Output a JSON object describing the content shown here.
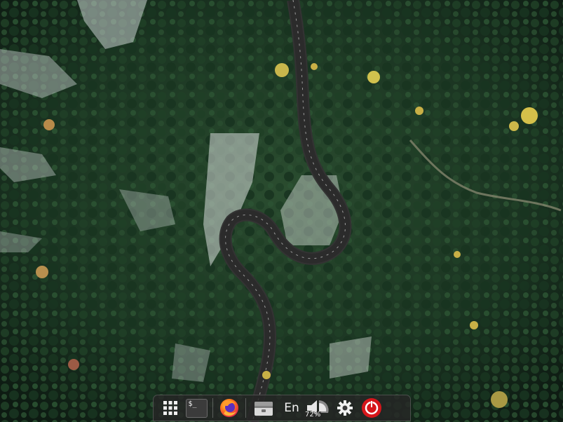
{
  "desktop": {
    "wallpaper": "aerial-forest-road"
  },
  "dock": {
    "items": [
      {
        "name": "app-grid-icon",
        "label": ""
      },
      {
        "name": "terminal-icon",
        "label": "$_"
      },
      {
        "name": "firefox-icon",
        "label": ""
      },
      {
        "name": "files-icon",
        "label": ""
      }
    ],
    "keyboard_layout": "En",
    "volume_percent": "72%",
    "volume_level": 0.72,
    "accent_power": "#d6161b"
  }
}
